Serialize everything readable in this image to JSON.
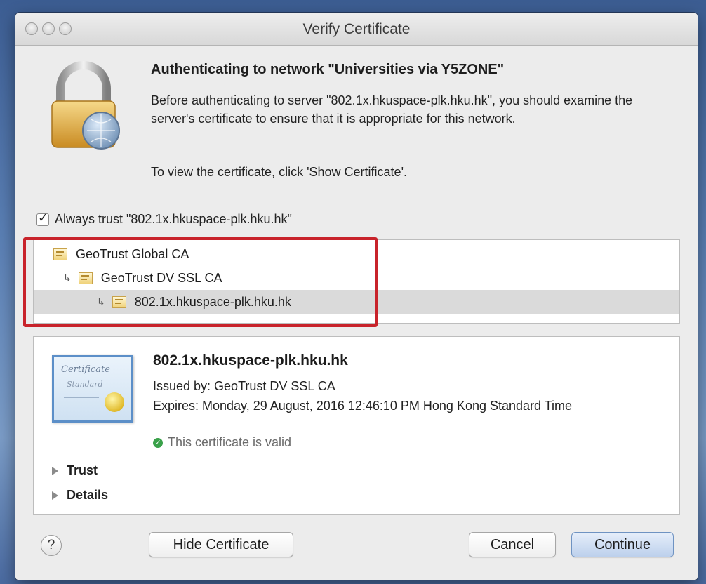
{
  "window": {
    "title": "Verify Certificate"
  },
  "header": {
    "heading": "Authenticating to network \"Universities via Y5ZONE\"",
    "message": "Before authenticating to server \"802.1x.hkuspace-plk.hku.hk\", you should examine the server's certificate to ensure that it is appropriate for this network.",
    "instruction": "To view the certificate, click 'Show Certificate'."
  },
  "trust_checkbox": {
    "label": "Always trust \"802.1x.hkuspace-plk.hku.hk\"",
    "checked": true
  },
  "chain": [
    {
      "label": "GeoTrust Global CA"
    },
    {
      "label": "GeoTrust DV SSL CA"
    },
    {
      "label": "802.1x.hkuspace-plk.hku.hk"
    }
  ],
  "certificate": {
    "name": "802.1x.hkuspace-plk.hku.hk",
    "issued_by": "Issued by: GeoTrust DV SSL CA",
    "expires": "Expires: Monday, 29 August, 2016 12:46:10 PM Hong Kong Standard Time",
    "status": "This certificate is valid",
    "icon_text1": "Certificate",
    "icon_text2": "Standard"
  },
  "sections": {
    "trust": "Trust",
    "details": "Details"
  },
  "buttons": {
    "help": "?",
    "hide": "Hide Certificate",
    "cancel": "Cancel",
    "continue": "Continue"
  },
  "colors": {
    "highlight": "#c8232b",
    "valid": "#3aa14a",
    "accent": "#5c8fc8"
  }
}
